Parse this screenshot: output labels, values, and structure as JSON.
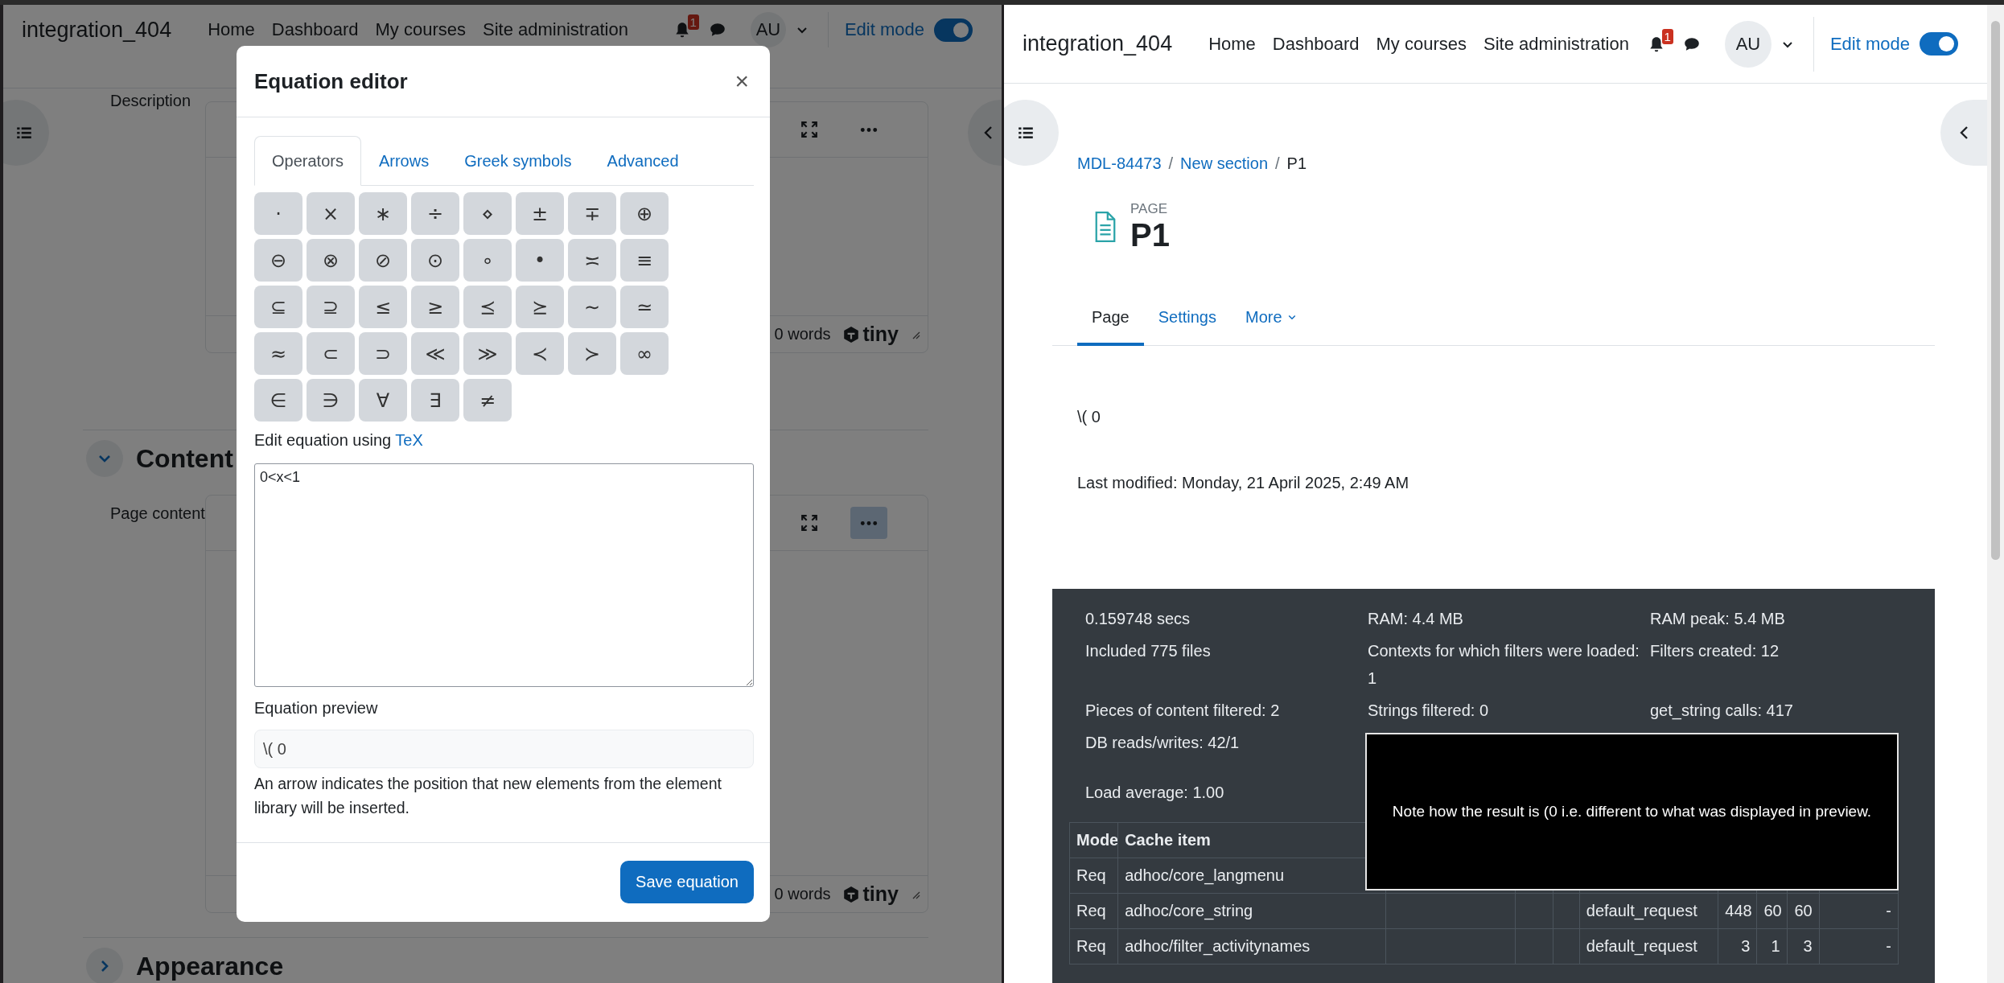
{
  "left_window": {
    "header": {
      "site_name": "integration_404",
      "nav": [
        "Home",
        "Dashboard",
        "My courses",
        "Site administration"
      ],
      "notification_count": "1",
      "avatar": "AU",
      "edit_mode": {
        "label": "Edit mode",
        "on": true
      }
    },
    "form": {
      "description": {
        "label": "Description",
        "editor": {
          "word_count": "0 words",
          "brand": "tiny",
          "more_active": false
        }
      },
      "sections": [
        {
          "title": "Content",
          "expanded": true,
          "field": {
            "label": "Page content",
            "editor": {
              "word_count": "0 words",
              "brand": "tiny",
              "more_active": true
            }
          }
        },
        {
          "title": "Appearance",
          "expanded": false
        }
      ]
    }
  },
  "equation_editor": {
    "title": "Equation editor",
    "close": "×",
    "tabs": [
      {
        "label": "Operators",
        "selected": true
      },
      {
        "label": "Arrows",
        "selected": false
      },
      {
        "label": "Greek symbols",
        "selected": false
      },
      {
        "label": "Advanced",
        "selected": false
      }
    ],
    "symbols": [
      "·",
      "×",
      "∗",
      "÷",
      "⋄",
      "±",
      "∓",
      "⊕",
      "⊖",
      "⊗",
      "⊘",
      "⊙",
      "∘",
      "•",
      "≍",
      "≡",
      "⊆",
      "⊇",
      "≤",
      "≥",
      "⪯",
      "⪰",
      "∼",
      "≃",
      "≈",
      "⊂",
      "⊃",
      "≪",
      "≫",
      "≺",
      "≻",
      "∞",
      "∈",
      "∋",
      "∀",
      "∃",
      "≠"
    ],
    "tex_prompt": "Edit equation using",
    "tex_link": "TeX",
    "equation": "0<x<1",
    "preview_label": "Equation preview",
    "preview": "\\( 0",
    "help": "An arrow indicates the position that new elements from the element library will be inserted.",
    "save_label": "Save equation"
  },
  "right_window": {
    "header": {
      "site_name": "integration_404",
      "nav": [
        "Home",
        "Dashboard",
        "My courses",
        "Site administration"
      ],
      "notification_count": "1",
      "avatar": "AU",
      "edit_mode": {
        "label": "Edit mode",
        "on": true
      }
    },
    "breadcrumb": [
      {
        "label": "MDL-84473",
        "current": false,
        "separator": "/"
      },
      {
        "label": "New section",
        "current": false,
        "separator": "/"
      },
      {
        "label": "P1",
        "current": true
      }
    ],
    "activity_type": "PAGE",
    "title": "P1",
    "tabs": [
      {
        "label": "Page",
        "selected": true,
        "kind": "link"
      },
      {
        "label": "Settings",
        "selected": false,
        "kind": "link"
      },
      {
        "label": "More",
        "selected": false,
        "kind": "menu"
      }
    ],
    "content": "\\( 0",
    "last_modified": "Last modified: Monday, 21 April 2025, 2:49 AM",
    "performance": {
      "stats": [
        [
          "0.159748 secs",
          "RAM: 4.4 MB",
          "RAM peak: 5.4 MB"
        ],
        [
          "Included 775 files",
          "Contexts for which filters were loaded: 1",
          "Filters created: 12"
        ],
        [
          "Pieces of content filtered: 2",
          "Strings filtered: 0",
          "get_string calls: 417"
        ],
        [
          "DB reads/writes: 42/1"
        ],
        [
          "Load average: 1.00"
        ]
      ],
      "cache_table": {
        "columns": [
          "Mode",
          "Cache item"
        ],
        "rows": [
          {
            "mode": "Req",
            "cache_item": "adhoc/core_langmenu"
          },
          {
            "mode": "Req",
            "cache_item": "adhoc/core_string",
            "column_6": "default_request",
            "column_7": "448",
            "column_8": "60",
            "column_9": "60",
            "column_10": "-"
          },
          {
            "mode": "Req",
            "cache_item": "adhoc/filter_activitynames",
            "column_6": "default_request",
            "column_7": "3",
            "column_8": "1",
            "column_9": "3",
            "column_10": "-"
          }
        ]
      }
    },
    "annotation": "Note how the result is (0 i.e. different to what was displayed in preview."
  }
}
